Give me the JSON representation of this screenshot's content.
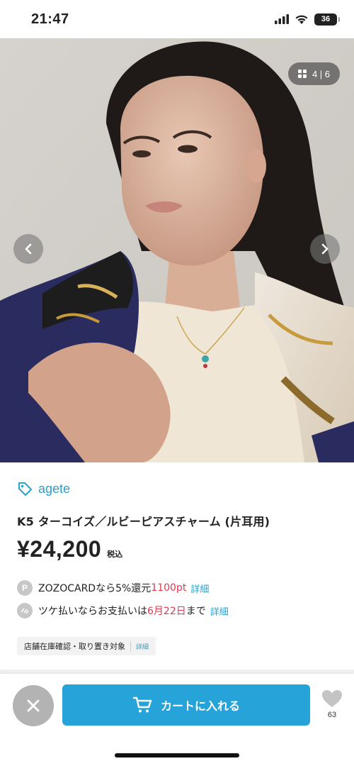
{
  "status_bar": {
    "time": "21:47",
    "battery": "36"
  },
  "gallery": {
    "counter": "4 | 6",
    "icons": {
      "grid": "grid-icon",
      "prev": "chevron-left-icon",
      "next": "chevron-right-icon"
    },
    "current_index": 4,
    "total": 6
  },
  "product": {
    "brand": "agete",
    "brand_icon": "tag-icon",
    "title": "K5 ターコイズ／ルビーピアスチャーム (片耳用)",
    "price": "¥24,200",
    "tax_label": "税込",
    "points_line": {
      "icon_letter": "P",
      "text_before": "ZOZOCARDなら5%還元",
      "points": "1100pt",
      "link": "詳細"
    },
    "tsuke_line": {
      "text_before": "ツケ払いならお支払いは",
      "date": "6月22日",
      "text_after": "まで",
      "link": "詳細"
    },
    "store_tag": {
      "label": "店舗在庫確認・取り置き対象",
      "link": "詳細"
    }
  },
  "bottom_bar": {
    "close_icon": "close-icon",
    "cart_label": "カートに入れる",
    "cart_icon": "cart-icon",
    "favorite_icon": "heart-icon",
    "favorite_count": "63"
  },
  "colors": {
    "accent": "#26a3d9",
    "link": "#2aa1cc",
    "highlight": "#e0384e"
  }
}
